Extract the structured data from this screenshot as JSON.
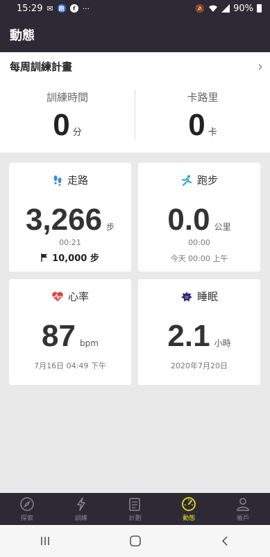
{
  "status_bar": {
    "time": "15:29",
    "battery": "90%",
    "left_icons": [
      "mail-icon",
      "app-badge-icon",
      "facebook-icon",
      "more-icon"
    ],
    "right_icons": [
      "mute-icon",
      "wifi-icon",
      "signal-icon",
      "battery-icon"
    ]
  },
  "app_bar": {
    "title": "動態"
  },
  "weekly_plan": {
    "title": "每周訓練計畫",
    "training_time_label": "訓練時間",
    "training_time_value": "0",
    "training_time_unit": "分",
    "calories_label": "卡路里",
    "calories_value": "0",
    "calories_unit": "卡"
  },
  "cards": {
    "walking": {
      "title": "走路",
      "value": "3,266",
      "unit": "步",
      "time": "00:21",
      "goal": "10,000 步"
    },
    "running": {
      "title": "跑步",
      "value": "0.0",
      "unit": "公里",
      "duration": "00:00",
      "last": "今天 00:00 上午"
    },
    "heart": {
      "title": "心率",
      "value": "87",
      "unit": "bpm",
      "time": "7月16日 04:49 下午"
    },
    "sleep": {
      "title": "睡眠",
      "value": "2.1",
      "unit": "小時",
      "date": "2020年7月20日"
    }
  },
  "bottom_nav": {
    "items": [
      {
        "label": "探索",
        "icon": "compass-icon"
      },
      {
        "label": "訓練",
        "icon": "lightning-icon"
      },
      {
        "label": "計劃",
        "icon": "clipboard-icon"
      },
      {
        "label": "動態",
        "icon": "gauge-icon",
        "active": true
      },
      {
        "label": "帳戶",
        "icon": "person-icon"
      }
    ]
  },
  "colors": {
    "dark_bar": "#2e2a35",
    "active_nav": "#e6df1c",
    "walk_icon": "#3a8fd0",
    "run_icon": "#2ea0d8",
    "heart_icon": "#e04545",
    "sleep_icon": "#2a2a7a"
  }
}
